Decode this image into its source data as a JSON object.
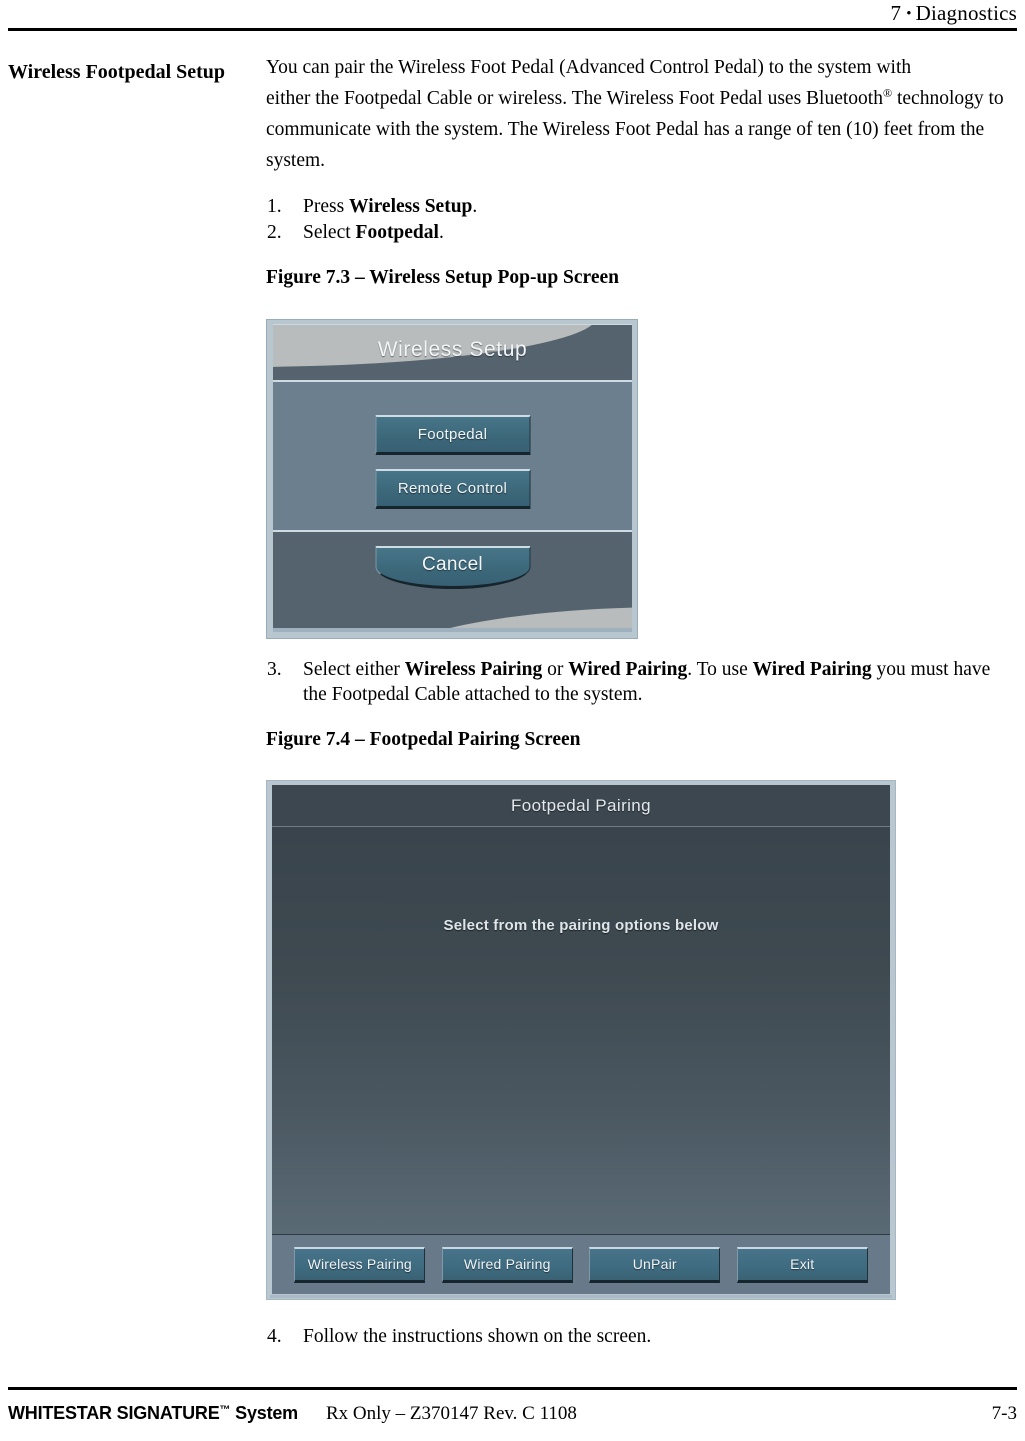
{
  "header": {
    "chapter_number": "7",
    "bullet": "•",
    "chapter_title": "Diagnostics"
  },
  "side_heading": "Wireless Footpedal Setup",
  "intro": {
    "line1": "You can pair the Wireless Foot Pedal (Advanced Control Pedal) to the system with",
    "line2_before_sup": "either the Footpedal Cable or wireless. The Wireless Foot Pedal uses Bluetooth",
    "registered_mark": "®",
    "line2_after_sup": " technology to communicate with the system. The Wireless Foot Pedal has a range of ten (10) feet from the system."
  },
  "steps": [
    {
      "num": "1.",
      "pre": "Press ",
      "bold": "Wireless Setup",
      "post": "."
    },
    {
      "num": "2.",
      "pre": "Select ",
      "bold": "Footpedal",
      "post": "."
    }
  ],
  "step3": {
    "num": "3.",
    "t1": "Select either ",
    "b1": "Wireless Pairing",
    "t2": " or ",
    "b2": "Wired Pairing",
    "t3": ". To use ",
    "b3": "Wired Pairing",
    "t4": " you must have the Footpedal Cable attached to the system."
  },
  "step4": {
    "num": "4.",
    "text": "Follow the instructions shown on the screen."
  },
  "figure_73": {
    "caption": "Figure 7.3 – Wireless Setup Pop-up Screen",
    "dialog": {
      "title": "Wireless Setup",
      "buttons": [
        {
          "label": "Footpedal"
        },
        {
          "label": "Remote Control"
        }
      ],
      "cancel_label": "Cancel"
    }
  },
  "figure_74": {
    "caption": "Figure 7.4 – Footpedal Pairing Screen",
    "screen": {
      "title": "Footpedal Pairing",
      "hint": "Select from the pairing options below",
      "buttons": [
        {
          "label": "Wireless Pairing"
        },
        {
          "label": "Wired Pairing"
        },
        {
          "label": "UnPair"
        },
        {
          "label": "Exit"
        }
      ]
    }
  },
  "footer": {
    "product_name": "WHITESTAR SIGNATURE",
    "trademark": "™",
    "product_suffix": " System",
    "center": "Rx Only – Z370147 Rev. C 1108",
    "page_number": "7-3"
  },
  "colors": {
    "dialog_frame": "#b8c6d0",
    "dialog_titlebar": "#54636e",
    "dialog_body": "#6b7f8f",
    "button_teal": "#3f6b80",
    "screen_dark": "#39444c",
    "screen_bar": "#68798a",
    "swoosh_gray": "#b9bcbd"
  }
}
